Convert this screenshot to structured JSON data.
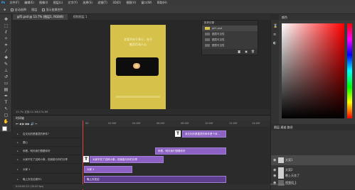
{
  "menubar": {
    "logo": "Ps",
    "items": [
      "文件(F)",
      "编辑(E)",
      "图像(I)",
      "图层(L)",
      "文字(Y)",
      "选择(S)",
      "滤镜(T)",
      "3D(D)",
      "视图(V)",
      "窗口(W)",
      "帮助(H)"
    ]
  },
  "options": {
    "auto_select": "自动选择:",
    "layer": "图层",
    "show_transform": "显示变换控件"
  },
  "document": {
    "tab_active": "gif1.psd @ 13.7% (图层1, RGB/8)",
    "tab_other": "视频图层 1"
  },
  "artboard": {
    "line1": "文案不在于多少，在于",
    "line2": "能否打动人心"
  },
  "status": {
    "text": "13.7%  文档:12.1M/174.3M"
  },
  "history": {
    "title": "历史记录",
    "items": [
      "gif1.psd",
      "图层可见性",
      "图层可见性",
      "图层可见性"
    ]
  },
  "color_panel": {
    "title": "颜色"
  },
  "layers": {
    "tabs": "图层  通道  路径",
    "rows": [
      {
        "name": "文案1"
      },
      {
        "name": "文案2"
      },
      {
        "name": "晚上天花了"
      },
      {
        "name": "视频组 1"
      }
    ]
  },
  "timeline": {
    "title": "时间轴",
    "controls": "⏮ ◀ ▶ ▶▶ 🔊 ✂",
    "ruler": [
      "00",
      "02:00f",
      "04:00f",
      "06:00f",
      "08:00f",
      "10:00f",
      "12:00f",
      "14:00f"
    ],
    "tracks": [
      "否文化的是善意的条件?",
      "要心",
      "来看，明天我们想要你好",
      "大家不在了这种小事，但我能与你们分享",
      "大家 1",
      "晚上天花边绿升1"
    ],
    "clips": [
      {
        "label": "我文化的是善意的条件是个体..."
      },
      {
        "label": "来看，明天我们想要你好"
      },
      {
        "label": "大家不在了这种小事，但我能与你们分享"
      },
      {
        "label": "大家 1"
      },
      {
        "label": "晚上天花边"
      }
    ],
    "footer": "0:00:00:12  (30.00 fps)"
  },
  "watermark": "https://blog.csdn.net"
}
